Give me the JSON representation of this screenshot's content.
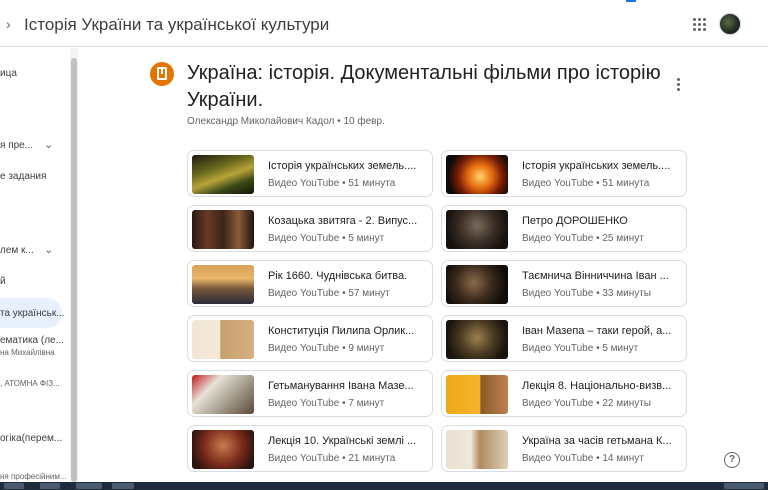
{
  "header": {
    "title": "Історія України та української культури"
  },
  "sidebar": {
    "items": [
      {
        "label": "ица"
      },
      {
        "label": "я пре..."
      },
      {
        "label": "е задания"
      },
      {
        "label": "лем к..."
      },
      {
        "label": "й"
      },
      {
        "label": "та українськ..."
      },
      {
        "label": "ематика (ле...",
        "sub": "на Михайлівна"
      },
      {
        "label": ", АТОМНА ФІЗ..."
      },
      {
        "label": "огіка(перем..."
      },
      {
        "label": "ня професійним..."
      }
    ]
  },
  "post": {
    "title": "Україна: історія. Документальні фільми про історію України.",
    "author": "Олександр Миколайович Кадол",
    "date": "10 февр.",
    "meta": "Олександр Миколайович Кадол • 10 февр."
  },
  "materials": [
    {
      "title": "Історія українських земель....",
      "sub": "Видео YouTube • 51 минута"
    },
    {
      "title": "Історія українських земель....",
      "sub": "Видео YouTube • 51 минута"
    },
    {
      "title": "Козацька звитяга - 2. Випус...",
      "sub": "Видео YouTube • 5 минут"
    },
    {
      "title": "Петро ДОРОШЕНКО",
      "sub": "Видео YouTube • 25 минут"
    },
    {
      "title": "Рік 1660. Чуднівська битва.",
      "sub": "Видео YouTube • 57 минут"
    },
    {
      "title": "Таємнича Вінниччина Іван ...",
      "sub": "Видео YouTube • 33 минуты"
    },
    {
      "title": "Конституція Пилипа Орлик...",
      "sub": "Видео YouTube • 9 минут"
    },
    {
      "title": "Іван Мазепа – таки герой, а...",
      "sub": "Видео YouTube • 5 минут"
    },
    {
      "title": "Гетьманування Івана Мазе...",
      "sub": "Видео YouTube • 7 минут"
    },
    {
      "title": "Лекція 8. Національно-визв...",
      "sub": "Видео YouTube • 22 минуты"
    },
    {
      "title": "Лекція 10. Українські землі ...",
      "sub": "Видео YouTube • 21 минута"
    },
    {
      "title": "Україна за часів гетьмана К...",
      "sub": "Видео YouTube • 14 минут"
    }
  ],
  "help": {
    "label": "?"
  },
  "icons": {
    "header_back": "chevron-right-icon",
    "apps": "apps-grid-icon",
    "post_type": "material-icon",
    "more": "more-vert-icon",
    "help": "help-icon"
  },
  "colors": {
    "accent": "#e37400",
    "active_nav": "#e8f0fe",
    "border": "#dadce0"
  }
}
